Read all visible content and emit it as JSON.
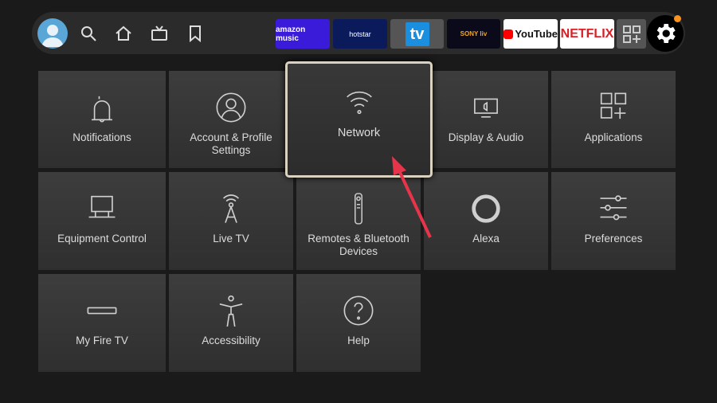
{
  "topbar": {
    "nav": [
      {
        "icon": "search-icon"
      },
      {
        "icon": "home-icon"
      },
      {
        "icon": "live-tv-icon"
      },
      {
        "icon": "bookmark-icon"
      }
    ],
    "apps": [
      {
        "label": "amazon music",
        "bg": "#3a1bd9",
        "fg": "#ffffff"
      },
      {
        "label": "hotstar",
        "bg": "#0b1a5a",
        "fg": "#ffffff"
      },
      {
        "label": "tv",
        "bg": "#555555",
        "fg": "#ffffff"
      },
      {
        "label": "SONY liv",
        "bg": "#0a0a1a",
        "fg": "#ffffff"
      },
      {
        "label": "YouTube",
        "bg": "#ffffff",
        "fg": "#111111"
      },
      {
        "label": "NETFLIX",
        "bg": "#ffffff",
        "fg": "#d81f26"
      }
    ],
    "settings_notification_color": "#f7931e"
  },
  "tiles": [
    {
      "label": "Notifications",
      "icon": "bell-icon"
    },
    {
      "label": "Account & Profile Settings",
      "icon": "profile-icon"
    },
    {
      "label": "Network",
      "icon": "wifi-icon"
    },
    {
      "label": "Display & Audio",
      "icon": "display-icon"
    },
    {
      "label": "Applications",
      "icon": "applications-icon"
    },
    {
      "label": "Equipment Control",
      "icon": "equipment-icon"
    },
    {
      "label": "Live TV",
      "icon": "antenna-icon"
    },
    {
      "label": "Remotes & Bluetooth Devices",
      "icon": "remote-icon"
    },
    {
      "label": "Alexa",
      "icon": "alexa-icon"
    },
    {
      "label": "Preferences",
      "icon": "sliders-icon"
    },
    {
      "label": "My Fire TV",
      "icon": "fire-tv-icon"
    },
    {
      "label": "Accessibility",
      "icon": "accessibility-icon"
    },
    {
      "label": "Help",
      "icon": "help-icon"
    }
  ],
  "focused_tile": "Network",
  "annotation_color": "#e8344a"
}
